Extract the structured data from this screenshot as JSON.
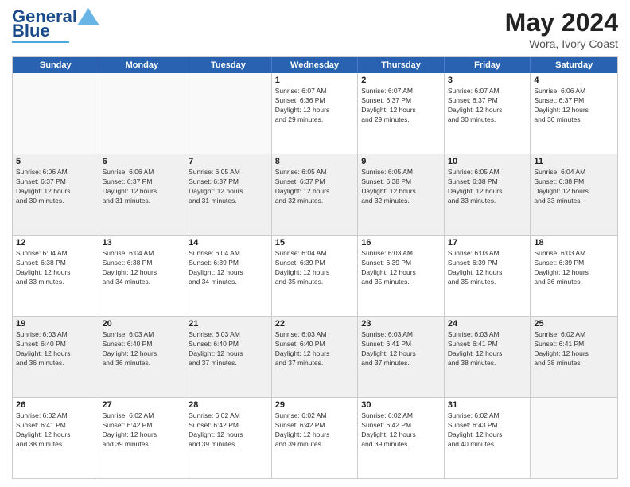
{
  "header": {
    "logo_line1": "General",
    "logo_line2": "Blue",
    "main_title": "May 2024",
    "sub_title": "Wora, Ivory Coast"
  },
  "days_of_week": [
    "Sunday",
    "Monday",
    "Tuesday",
    "Wednesday",
    "Thursday",
    "Friday",
    "Saturday"
  ],
  "weeks": [
    [
      {
        "day": "",
        "info": ""
      },
      {
        "day": "",
        "info": ""
      },
      {
        "day": "",
        "info": ""
      },
      {
        "day": "1",
        "info": "Sunrise: 6:07 AM\nSunset: 6:36 PM\nDaylight: 12 hours\nand 29 minutes."
      },
      {
        "day": "2",
        "info": "Sunrise: 6:07 AM\nSunset: 6:37 PM\nDaylight: 12 hours\nand 29 minutes."
      },
      {
        "day": "3",
        "info": "Sunrise: 6:07 AM\nSunset: 6:37 PM\nDaylight: 12 hours\nand 30 minutes."
      },
      {
        "day": "4",
        "info": "Sunrise: 6:06 AM\nSunset: 6:37 PM\nDaylight: 12 hours\nand 30 minutes."
      }
    ],
    [
      {
        "day": "5",
        "info": "Sunrise: 6:06 AM\nSunset: 6:37 PM\nDaylight: 12 hours\nand 30 minutes."
      },
      {
        "day": "6",
        "info": "Sunrise: 6:06 AM\nSunset: 6:37 PM\nDaylight: 12 hours\nand 31 minutes."
      },
      {
        "day": "7",
        "info": "Sunrise: 6:05 AM\nSunset: 6:37 PM\nDaylight: 12 hours\nand 31 minutes."
      },
      {
        "day": "8",
        "info": "Sunrise: 6:05 AM\nSunset: 6:37 PM\nDaylight: 12 hours\nand 32 minutes."
      },
      {
        "day": "9",
        "info": "Sunrise: 6:05 AM\nSunset: 6:38 PM\nDaylight: 12 hours\nand 32 minutes."
      },
      {
        "day": "10",
        "info": "Sunrise: 6:05 AM\nSunset: 6:38 PM\nDaylight: 12 hours\nand 33 minutes."
      },
      {
        "day": "11",
        "info": "Sunrise: 6:04 AM\nSunset: 6:38 PM\nDaylight: 12 hours\nand 33 minutes."
      }
    ],
    [
      {
        "day": "12",
        "info": "Sunrise: 6:04 AM\nSunset: 6:38 PM\nDaylight: 12 hours\nand 33 minutes."
      },
      {
        "day": "13",
        "info": "Sunrise: 6:04 AM\nSunset: 6:38 PM\nDaylight: 12 hours\nand 34 minutes."
      },
      {
        "day": "14",
        "info": "Sunrise: 6:04 AM\nSunset: 6:39 PM\nDaylight: 12 hours\nand 34 minutes."
      },
      {
        "day": "15",
        "info": "Sunrise: 6:04 AM\nSunset: 6:39 PM\nDaylight: 12 hours\nand 35 minutes."
      },
      {
        "day": "16",
        "info": "Sunrise: 6:03 AM\nSunset: 6:39 PM\nDaylight: 12 hours\nand 35 minutes."
      },
      {
        "day": "17",
        "info": "Sunrise: 6:03 AM\nSunset: 6:39 PM\nDaylight: 12 hours\nand 35 minutes."
      },
      {
        "day": "18",
        "info": "Sunrise: 6:03 AM\nSunset: 6:39 PM\nDaylight: 12 hours\nand 36 minutes."
      }
    ],
    [
      {
        "day": "19",
        "info": "Sunrise: 6:03 AM\nSunset: 6:40 PM\nDaylight: 12 hours\nand 36 minutes."
      },
      {
        "day": "20",
        "info": "Sunrise: 6:03 AM\nSunset: 6:40 PM\nDaylight: 12 hours\nand 36 minutes."
      },
      {
        "day": "21",
        "info": "Sunrise: 6:03 AM\nSunset: 6:40 PM\nDaylight: 12 hours\nand 37 minutes."
      },
      {
        "day": "22",
        "info": "Sunrise: 6:03 AM\nSunset: 6:40 PM\nDaylight: 12 hours\nand 37 minutes."
      },
      {
        "day": "23",
        "info": "Sunrise: 6:03 AM\nSunset: 6:41 PM\nDaylight: 12 hours\nand 37 minutes."
      },
      {
        "day": "24",
        "info": "Sunrise: 6:03 AM\nSunset: 6:41 PM\nDaylight: 12 hours\nand 38 minutes."
      },
      {
        "day": "25",
        "info": "Sunrise: 6:02 AM\nSunset: 6:41 PM\nDaylight: 12 hours\nand 38 minutes."
      }
    ],
    [
      {
        "day": "26",
        "info": "Sunrise: 6:02 AM\nSunset: 6:41 PM\nDaylight: 12 hours\nand 38 minutes."
      },
      {
        "day": "27",
        "info": "Sunrise: 6:02 AM\nSunset: 6:42 PM\nDaylight: 12 hours\nand 39 minutes."
      },
      {
        "day": "28",
        "info": "Sunrise: 6:02 AM\nSunset: 6:42 PM\nDaylight: 12 hours\nand 39 minutes."
      },
      {
        "day": "29",
        "info": "Sunrise: 6:02 AM\nSunset: 6:42 PM\nDaylight: 12 hours\nand 39 minutes."
      },
      {
        "day": "30",
        "info": "Sunrise: 6:02 AM\nSunset: 6:42 PM\nDaylight: 12 hours\nand 39 minutes."
      },
      {
        "day": "31",
        "info": "Sunrise: 6:02 AM\nSunset: 6:43 PM\nDaylight: 12 hours\nand 40 minutes."
      },
      {
        "day": "",
        "info": ""
      }
    ]
  ]
}
